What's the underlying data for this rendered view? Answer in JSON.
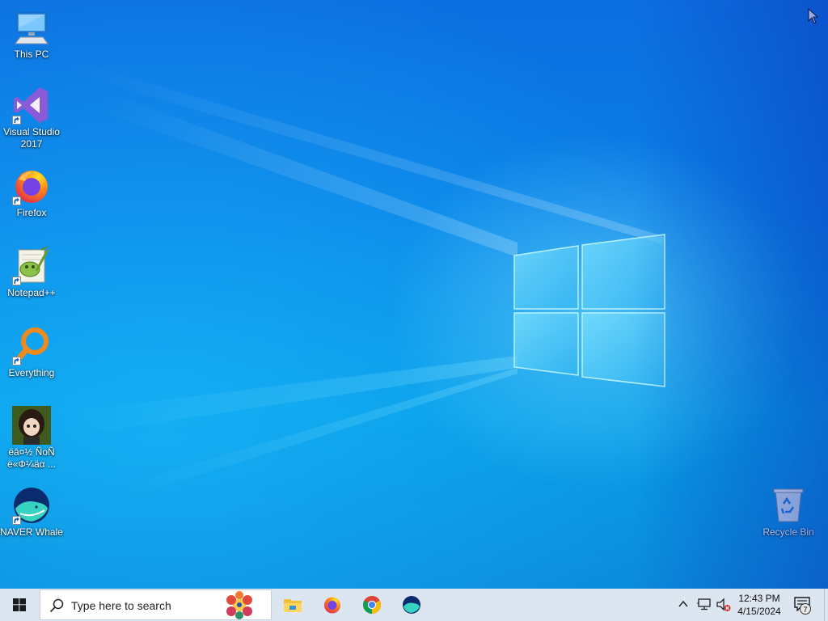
{
  "desktop": {
    "icons": [
      {
        "label": "This PC",
        "icon": "this-pc-icon"
      },
      {
        "label": "Visual Studio 2017",
        "icon": "visual-studio-icon"
      },
      {
        "label": "Firefox",
        "icon": "firefox-icon"
      },
      {
        "label": "Notepad++",
        "icon": "notepad-plus-plus-icon"
      },
      {
        "label": "Everything",
        "icon": "everything-icon"
      },
      {
        "label": "ëâ¤½ ÑoÑ",
        "label2": "ë«Φ¼äα ...",
        "icon": "anime-avatar-icon"
      },
      {
        "label": "NAVER Whale",
        "icon": "naver-whale-icon"
      },
      {
        "label": "Recycle Bin",
        "icon": "recycle-bin-icon"
      }
    ]
  },
  "taskbar": {
    "search_placeholder": "Type here to search",
    "pinned": [
      "file-explorer-icon",
      "firefox-icon",
      "chrome-icon",
      "naver-whale-icon"
    ],
    "clock": {
      "time": "12:43 PM",
      "date": "4/15/2024"
    },
    "notification_count": "7"
  },
  "colors": {
    "taskbar_bg": "#dbe6f1",
    "desktop_blue": "#0a7fe6",
    "accent_visual_studio": "#8a5bd6",
    "accent_everything": "#f08a1c"
  }
}
